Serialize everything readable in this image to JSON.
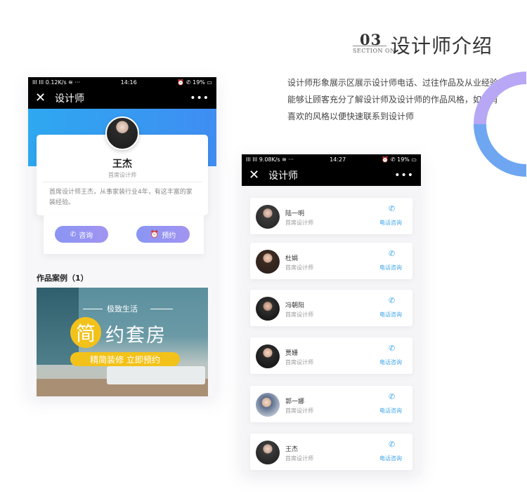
{
  "section": {
    "number": "03",
    "sub": "SECTION ON",
    "title": "设计师介绍",
    "description": "设计师形象展示区展示设计师电话、过往作品及从业经验能够让顾客充分了解设计师及设计师的作品风格，如果有喜欢的风格以便快速联系到设计师"
  },
  "phone1": {
    "status": {
      "left": "Ill Ill 0.12K/s ≋ ···",
      "time": "14:16",
      "right": "⏰ ✆ 19% ▭"
    },
    "title": "设计师",
    "close": "✕",
    "more": "•••",
    "designer": {
      "name": "王杰",
      "role": "首席设计师",
      "bio": "首席设计师王杰，从事家装行业4年，有这丰富的家装经验。"
    },
    "buttons": {
      "call": "咨询",
      "call_icon": "✆",
      "book": "预约",
      "book_icon": "⏰"
    },
    "works_title": "作品案例（1）",
    "banner": {
      "sub": "极致生活",
      "main_char": "简",
      "main_rest": "约套房",
      "tag": "精简装修 立即预约"
    }
  },
  "phone2": {
    "status": {
      "left": "Ill Ill 9.08K/s ≋ ···",
      "time": "14:27",
      "right": "⏰ ✆ 19% ▭"
    },
    "title": "设计师",
    "close": "✕",
    "more": "•••",
    "list": [
      {
        "name": "陆一明",
        "role": "首席设计师",
        "call": "电话咨询"
      },
      {
        "name": "杜娟",
        "role": "首席设计师",
        "call": "电话咨询"
      },
      {
        "name": "冯朝阳",
        "role": "首席设计师",
        "call": "电话咨询"
      },
      {
        "name": "贾姗",
        "role": "首席设计师",
        "call": "电话咨询"
      },
      {
        "name": "郭一娜",
        "role": "首席设计师",
        "call": "电话咨询"
      },
      {
        "name": "王杰",
        "role": "首席设计师",
        "call": "电话咨询"
      }
    ],
    "phone_icon": "✆"
  },
  "colors": {
    "accent_blue": "#3aa3e6",
    "pill_purple": "#8a95f3",
    "banner_yellow": "#f3c21a"
  }
}
